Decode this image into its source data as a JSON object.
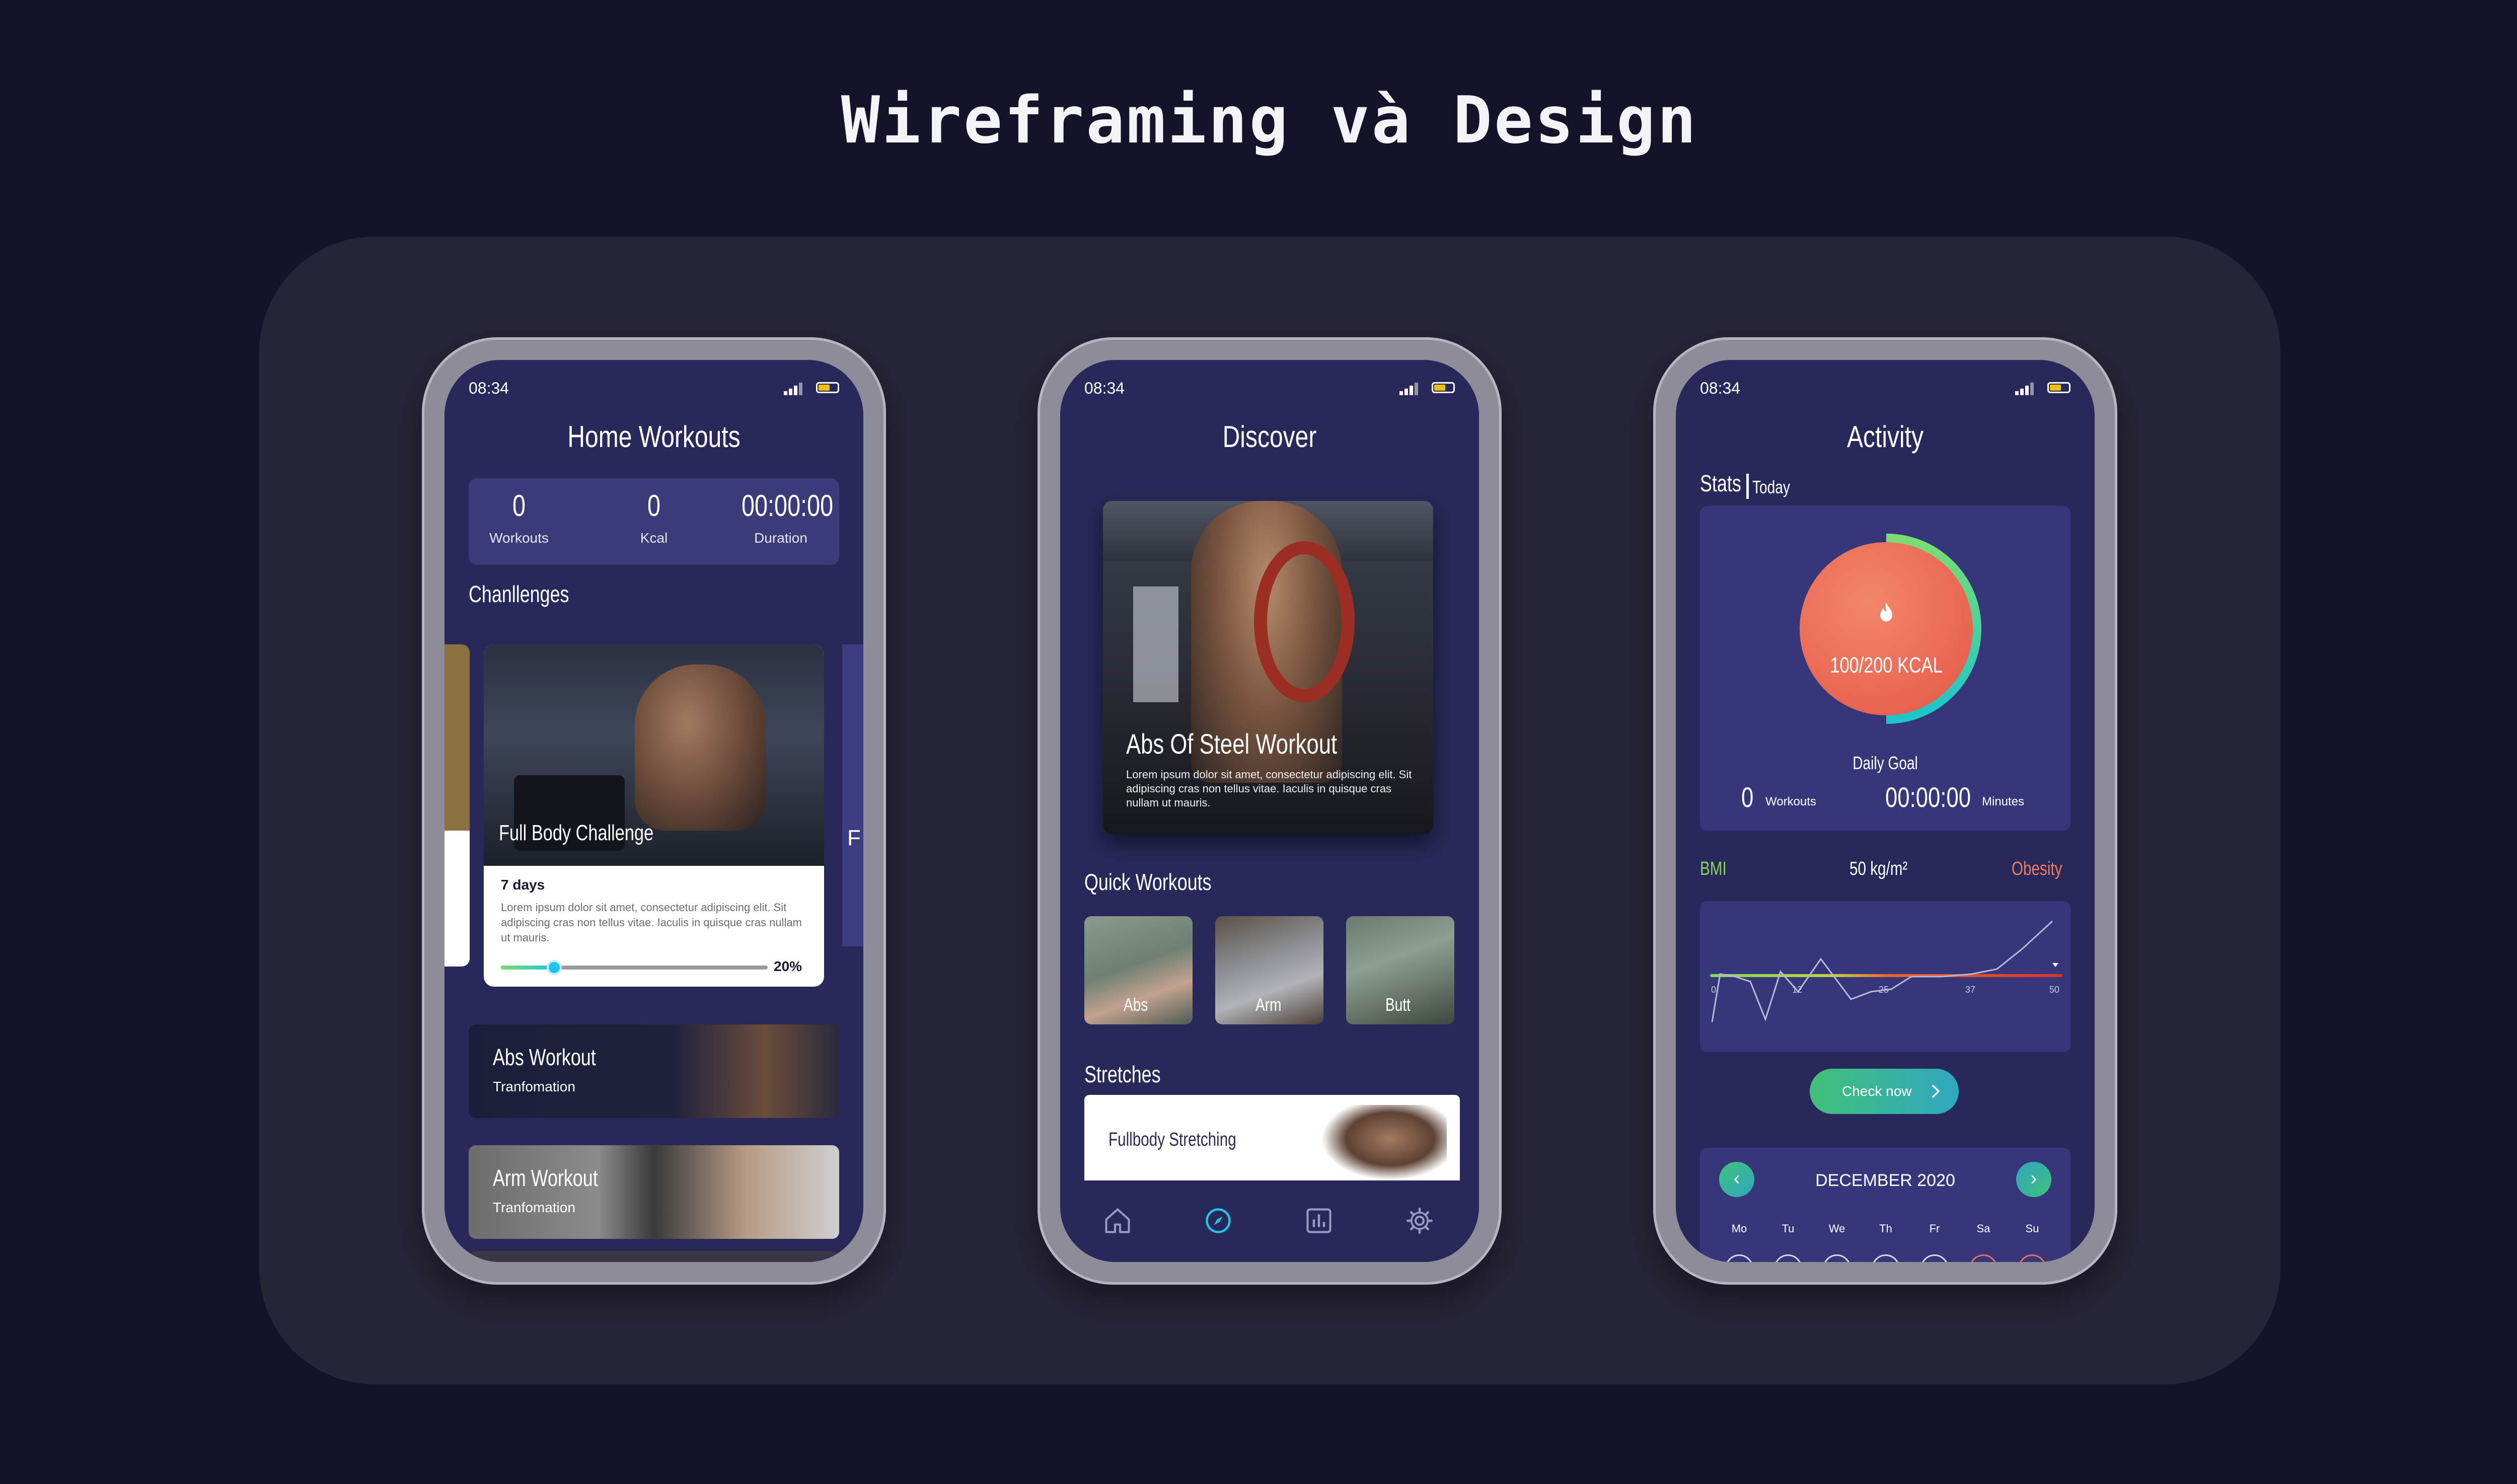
{
  "page": {
    "title": "Wireframing và Design"
  },
  "status": {
    "time": "08:34"
  },
  "home": {
    "title": "Home Workouts",
    "stats": [
      {
        "value": "0",
        "label": "Workouts"
      },
      {
        "value": "0",
        "label": "Kcal"
      },
      {
        "value": "00:00:00",
        "label": "Duration"
      }
    ],
    "challenges_label": "Chanllenges",
    "challenge": {
      "name": "Full Body Challenge",
      "days": "7 days",
      "description": "Lorem ipsum dolor sit amet, consectetur adipiscing elit. Sit adipiscing cras non tellus vitae. Iaculis in quisque cras nullam ut mauris.",
      "progress_label": "20%",
      "progress": 0.2
    },
    "side_card_letter": "F",
    "workouts": [
      {
        "name": "Abs Workout",
        "sub": "Tranfomation"
      },
      {
        "name": "Arm Workout",
        "sub": "Tranfomation"
      }
    ]
  },
  "discover": {
    "title": "Discover",
    "hero": {
      "name": "Abs Of Steel Workout",
      "description": "Lorem ipsum dolor sit amet, consectetur adipiscing elit. Sit adipiscing cras non tellus vitae. Iaculis in quisque cras nullam ut mauris."
    },
    "quick_label": "Quick Workouts",
    "quick": [
      "Abs",
      "Arm",
      "Butt"
    ],
    "stretches_label": "Stretches",
    "stretch": "Fullbody Stretching",
    "tabs": [
      "home-icon",
      "compass-icon",
      "chart-icon",
      "gear-icon"
    ],
    "active_tab": 1
  },
  "activity": {
    "title": "Activity",
    "stats_label": "Stats",
    "stats_period": "Today",
    "kcal": "100/200 KCAL",
    "kcal_progress": 0.5,
    "daily_goal": "Daily Goal",
    "workouts_value": "0",
    "workouts_label": "Workouts",
    "minutes_value": "00:00:00",
    "minutes_label": "Minutes",
    "bmi_label": "BMI",
    "bmi_value": "50 kg/m²",
    "bmi_status": "Obesity",
    "chart_ticks": [
      "0",
      "12",
      "25",
      "37",
      "50"
    ],
    "check_button": "Check now",
    "calendar_month": "DECEMBER 2020",
    "weekdays": [
      "Mo",
      "Tu",
      "We",
      "Th",
      "Fr",
      "Sa",
      "Su"
    ]
  },
  "colors": {
    "background": "#15132a",
    "panel": "#262437",
    "screen": "#28295a",
    "accent_teal": "#21c4e6",
    "accent_green": "#7dd96b",
    "accent_coral": "#ee6f5b",
    "bmi_green": "#8bd45b",
    "obesity": "#f07a5a"
  }
}
